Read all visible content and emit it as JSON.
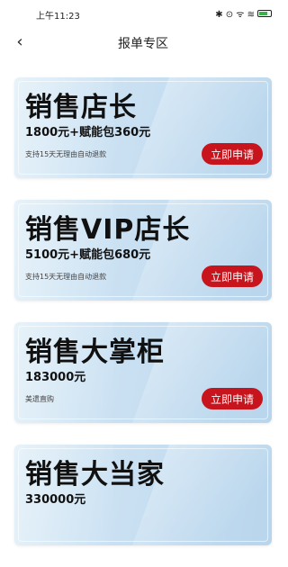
{
  "status": {
    "time": "上午11:23",
    "icons": "✱ ⊙ ᯤ ≋"
  },
  "nav": {
    "title": "报单专区",
    "back_symbol": "‹"
  },
  "cards": [
    {
      "title": "销售店长",
      "price": "1800元+赋能包360元",
      "note": "支持15天无理由自动退款",
      "button": "立即申请"
    },
    {
      "title": "销售VIP店长",
      "price": "5100元+赋能包680元",
      "note": "支持15天无理由自动退款",
      "button": "立即申请"
    },
    {
      "title": "销售大掌柜",
      "price": "183000元",
      "note": "美遗直购",
      "button": "立即申请"
    },
    {
      "title": "销售大当家",
      "price": "330000元",
      "note": "",
      "button": ""
    }
  ],
  "colors": {
    "accent": "#c8141c",
    "card_bg": "#c9e0f2"
  }
}
